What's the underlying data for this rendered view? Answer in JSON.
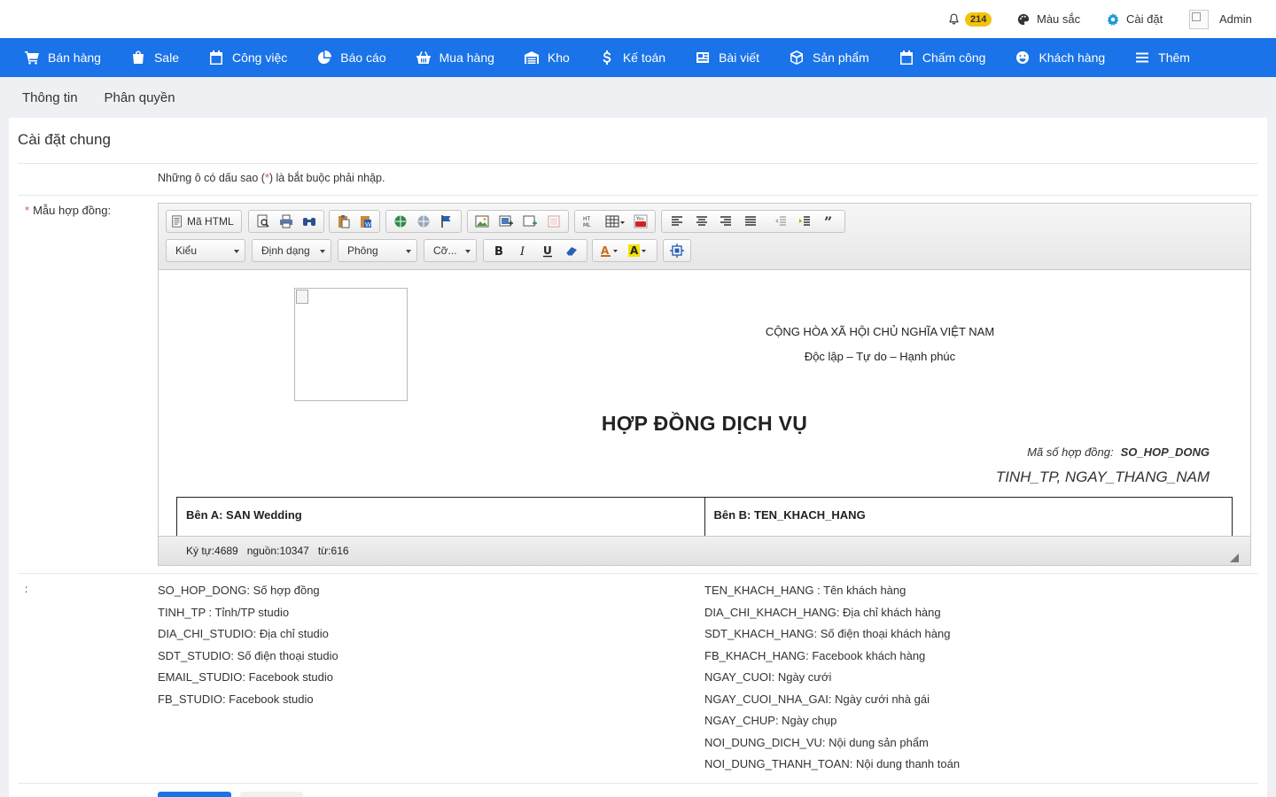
{
  "topbar": {
    "notifications_count": "214",
    "color_label": "Màu sắc",
    "settings_label": "Cài đặt",
    "user_label": "Admin"
  },
  "nav": {
    "items": [
      {
        "label": "Bán hàng",
        "icon": "cart-icon"
      },
      {
        "label": "Sale",
        "icon": "bag-icon"
      },
      {
        "label": "Công việc",
        "icon": "calendar-icon"
      },
      {
        "label": "Báo cáo",
        "icon": "pie-chart-icon"
      },
      {
        "label": "Mua hàng",
        "icon": "basket-icon"
      },
      {
        "label": "Kho",
        "icon": "warehouse-icon"
      },
      {
        "label": "Kế toán",
        "icon": "dollar-icon"
      },
      {
        "label": "Bài viết",
        "icon": "newspaper-icon"
      },
      {
        "label": "Sản phẩm",
        "icon": "box-icon"
      },
      {
        "label": "Chấm công",
        "icon": "calendar-check-icon"
      },
      {
        "label": "Khách hàng",
        "icon": "smile-icon"
      },
      {
        "label": "Thêm",
        "icon": "menu-icon"
      }
    ]
  },
  "subtabs": {
    "info": "Thông tin",
    "permissions": "Phân quyền"
  },
  "panel": {
    "title": "Cài đặt chung",
    "note_prefix": "Những ô có dấu sao (",
    "note_star": "*",
    "note_suffix": ") là bắt buộc phải nhập.",
    "contract_label": "Mẫu hợp đồng:",
    "colon_label": ":"
  },
  "editor": {
    "source_button": "Mã HTML",
    "style_combo": "Kiểu",
    "format_combo": "Định dạng",
    "font_combo": "Phông",
    "size_combo": "Cỡ...",
    "document": {
      "republic": "CỘNG HÒA XÃ HỘI CHỦ NGHĨA VIỆT NAM",
      "motto": "Độc lập – Tự do – Hạnh phúc",
      "title": "HỢP ĐỒNG DỊCH VỤ",
      "contract_no_label": "Mã số hợp đồng:",
      "contract_no_value": "SO_HOP_DONG",
      "place_date": "TINH_TP, NGAY_THANG_NAM",
      "party_a": "Bên A: SAN Wedding",
      "party_b": "Bên B: TEN_KHACH_HANG"
    },
    "status": {
      "chars": "Ký tự:4689",
      "source": "nguồn:10347",
      "words": "từ:616"
    }
  },
  "variables": {
    "left": [
      "SO_HOP_DONG: Số hợp đồng",
      "TINH_TP : Tỉnh/TP studio",
      "DIA_CHI_STUDIO: Địa chỉ studio",
      "SDT_STUDIO: Số điện thoại studio",
      "EMAIL_STUDIO: Facebook studio",
      "FB_STUDIO: Facebook studio"
    ],
    "right": [
      "TEN_KHACH_HANG : Tên khách hàng",
      "DIA_CHI_KHACH_HANG: Địa chỉ khách hàng",
      "SDT_KHACH_HANG: Số điện thoại khách hàng",
      "FB_KHACH_HANG: Facebook khách hàng",
      "NGAY_CUOI: Ngày cưới",
      "NGAY_CUOI_NHA_GAI: Ngày cưới nhà gái",
      "NGAY_CHUP: Ngày chụp",
      "NOI_DUNG_DICH_VU: Nội dung sản phẩm",
      "NOI_DUNG_THANH_TOAN: Nội dung thanh toán"
    ]
  },
  "colors": {
    "nav_bg": "#1a73e8",
    "badge": "#f4c20d",
    "required": "#d9534f"
  }
}
